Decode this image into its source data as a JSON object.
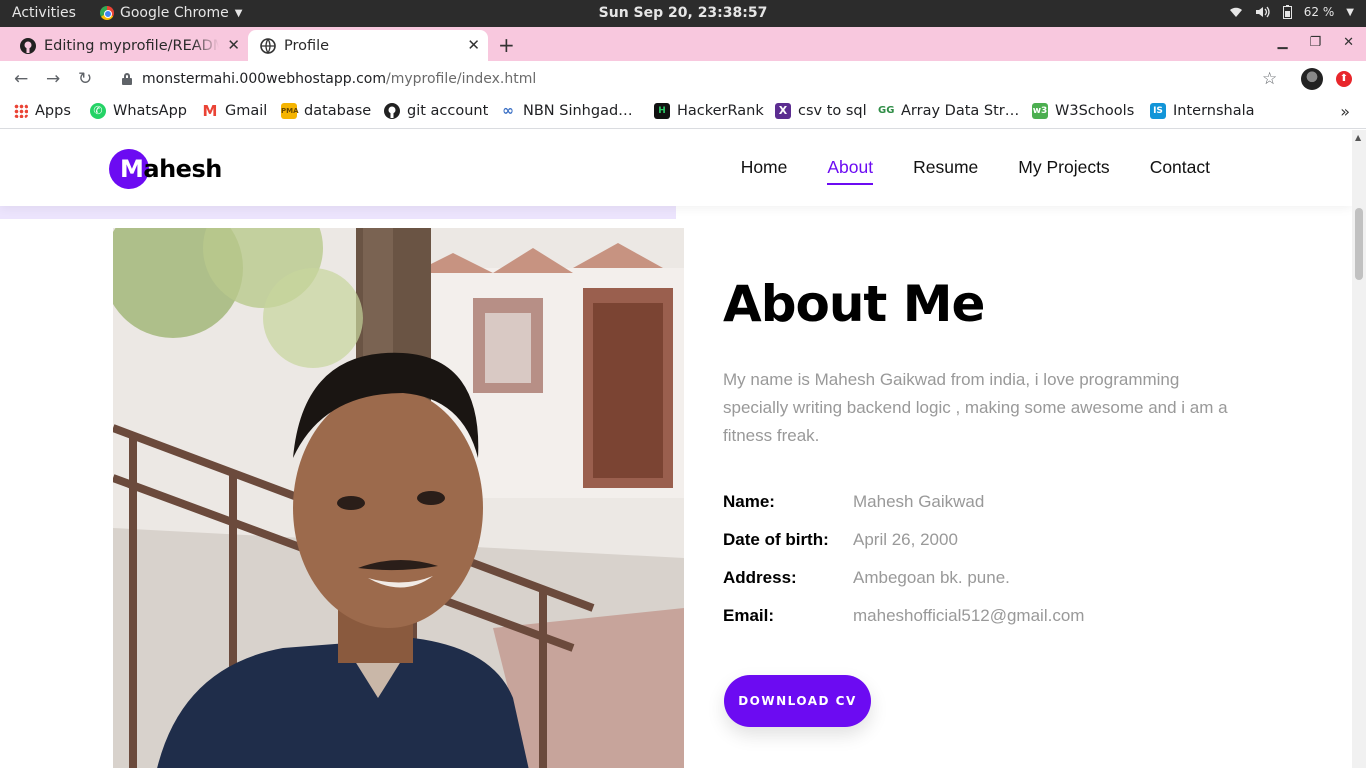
{
  "system_bar": {
    "activities": "Activities",
    "app_name": "Google Chrome",
    "clock": "Sun Sep 20, 23:38:57",
    "battery": "62 %"
  },
  "browser": {
    "tabs": [
      {
        "title": "Editing myprofile/README.md",
        "icon": "github-icon"
      },
      {
        "title": "Profile",
        "icon": "globe-icon"
      }
    ],
    "url_host": "monstermahi.000webhostapp.com",
    "url_path": "/myprofile/index.html",
    "bookmarks": [
      {
        "label": "Apps",
        "icon": "apps-grid-icon"
      },
      {
        "label": "WhatsApp",
        "icon": "whatsapp-icon"
      },
      {
        "label": "Gmail",
        "icon": "gmail-icon"
      },
      {
        "label": "database",
        "icon": "phpmyadmin-icon"
      },
      {
        "label": "git account",
        "icon": "github-icon"
      },
      {
        "label": "NBN Sinhgad…",
        "icon": "link-icon"
      },
      {
        "label": "HackerRank",
        "icon": "hackerrank-icon"
      },
      {
        "label": "csv to sql",
        "icon": "csvtosql-icon"
      },
      {
        "label": "Array Data Str…",
        "icon": "geeks-icon"
      },
      {
        "label": "W3Schools",
        "icon": "w3schools-icon"
      },
      {
        "label": "Internshala",
        "icon": "internshala-icon"
      }
    ]
  },
  "site": {
    "logo_first": "M",
    "logo_rest": "ahesh",
    "nav": [
      "Home",
      "About",
      "Resume",
      "My Projects",
      "Contact"
    ],
    "active_nav": "About",
    "about": {
      "title": "About Me",
      "description": "My name is Mahesh Gaikwad from india, i love programming specially writing backend logic , making some awesome and i am a fitness freak.",
      "fields": [
        {
          "label": "Name:",
          "value": "Mahesh Gaikwad"
        },
        {
          "label": "Date of birth:",
          "value": "April 26, 2000"
        },
        {
          "label": "Address:",
          "value": "Ambegoan bk. pune."
        },
        {
          "label": "Email:",
          "value": "maheshofficial512@gmail.com"
        }
      ],
      "cv_button": "DOWNLOAD CV"
    }
  },
  "colors": {
    "accent": "#6c0bf2",
    "tab_strip": "#f8c8de",
    "lavender": "#ece4fd"
  }
}
